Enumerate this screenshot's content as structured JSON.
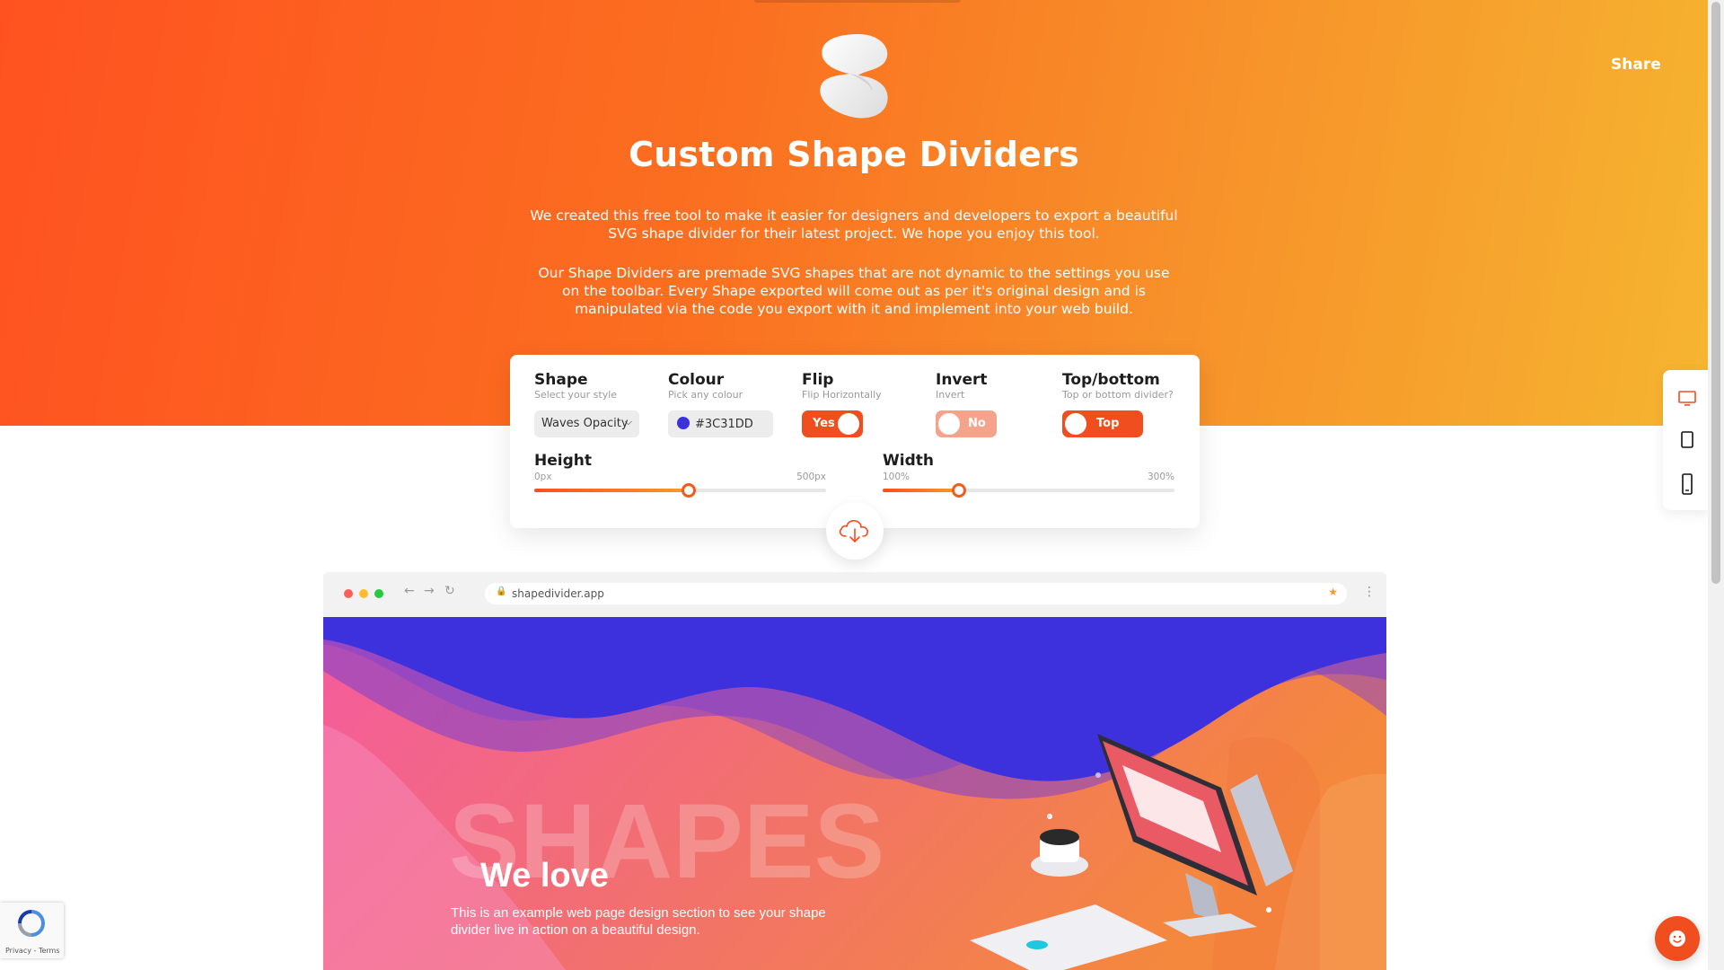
{
  "app": {
    "title": "Custom Shape Dividers",
    "intro_paragraph_1": "We created this free tool to make it easier for designers and developers to export a beautiful SVG shape divider for their latest project. We hope you enjoy this tool.",
    "intro_paragraph_2": "Our Shape Dividers are premade SVG shapes that are not dynamic to the settings you use on the toolbar. Every Shape exported will come out as per it's original design and is manipulated via the code you export with it and implement into your web build.",
    "share_label": "Share",
    "brand_colors": {
      "hero_start": "#ff5220",
      "hero_end": "#f6b530",
      "accent": "#f04e1e"
    }
  },
  "toolbar": {
    "shape": {
      "label": "Shape",
      "sublabel": "Select your style",
      "value": "Waves Opacity"
    },
    "colour": {
      "label": "Colour",
      "sublabel": "Pick any colour",
      "value": "#3C31DD"
    },
    "flip": {
      "label": "Flip",
      "sublabel": "Flip Horizontally",
      "value": "Yes",
      "on": true
    },
    "invert": {
      "label": "Invert",
      "sublabel": "Invert",
      "value": "No",
      "on": false
    },
    "position": {
      "label": "Top/bottom",
      "sublabel": "Top or bottom divider?",
      "value": "Top"
    },
    "height": {
      "label": "Height",
      "min_label": "0px",
      "max_label": "500px",
      "fraction": 0.53
    },
    "width": {
      "label": "Width",
      "min_label": "100%",
      "max_label": "300%",
      "fraction": 0.26
    },
    "download_icon": "cloud-download-icon"
  },
  "devices": [
    {
      "name": "desktop-icon",
      "active": true
    },
    {
      "name": "tablet-icon",
      "active": false
    },
    {
      "name": "mobile-icon",
      "active": false
    }
  ],
  "browser": {
    "url": "shapedivider.app",
    "preview": {
      "bg_word": "SHAPES",
      "headline": "We love",
      "body": "This is an example web page design section to see your shape divider live in action on a beautiful design.",
      "divider_color": "#3C31DD"
    }
  },
  "recaptcha": {
    "privacy": "Privacy",
    "terms": "Terms"
  }
}
